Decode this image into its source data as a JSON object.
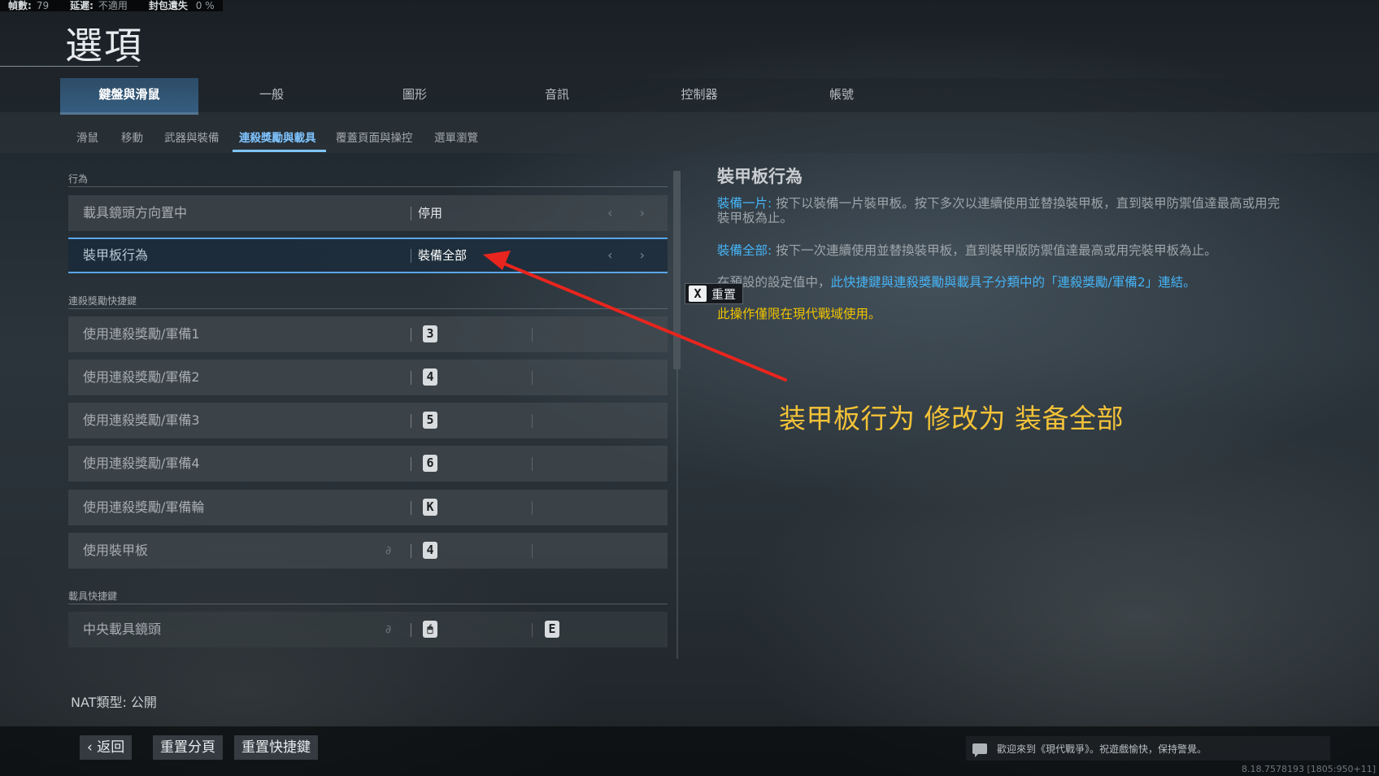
{
  "stats": [
    {
      "label": "幀數:",
      "value": "79"
    },
    {
      "label": "延遲:",
      "value": "不適用"
    },
    {
      "label": "封包遺失",
      "value": "0 %"
    }
  ],
  "page_title": "選項",
  "main_tabs": [
    "鍵盤與滑鼠",
    "一般",
    "圖形",
    "音訊",
    "控制器",
    "帳號"
  ],
  "sub_tabs": [
    "滑鼠",
    "移動",
    "武器與裝備",
    "連殺獎勵與載具",
    "覆蓋頁面與操控",
    "選單瀏覽"
  ],
  "sections": {
    "behavior": "行為",
    "killstreak": "連殺獎勵快捷鍵",
    "vehicle": "載具快捷鍵"
  },
  "rows": {
    "camera": {
      "label": "載具鏡頭方向置中",
      "value": "停用"
    },
    "armor_behavior": {
      "label": "裝甲板行為",
      "value": "裝備全部"
    },
    "ks1": {
      "label": "使用連殺獎勵/軍備1",
      "key": "3"
    },
    "ks2": {
      "label": "使用連殺獎勵/軍備2",
      "key": "4"
    },
    "ks3": {
      "label": "使用連殺獎勵/軍備3",
      "key": "5"
    },
    "ks4": {
      "label": "使用連殺獎勵/軍備4",
      "key": "6"
    },
    "ks_wheel": {
      "label": "使用連殺獎勵/軍備輪",
      "key": "K"
    },
    "use_armor": {
      "label": "使用裝甲板",
      "key": "4"
    },
    "center_cam": {
      "label": "中央載具鏡頭",
      "key": "🖱",
      "key2": "E"
    }
  },
  "arrows": "‹ ›",
  "detail": {
    "title": "裝甲板行為",
    "p1_hl": "裝備一片:",
    "p1": "按下以裝備一片裝甲板。按下多次以連續使用並替換裝甲板，直到裝甲防禦值達最高或用完裝甲板為止。",
    "p2_hl": "裝備全部:",
    "p2": "按下一次連續使用並替換裝甲板，直到裝甲版防禦值達最高或用完裝甲板為止。",
    "p3": "在預設的設定值中，",
    "p3_hl": "此快捷鍵與連殺獎勵與載具子分類中的「連殺獎勵/軍備2」連結。",
    "p4": "此操作僅限在現代戰域使用。"
  },
  "reset": {
    "key": "X",
    "label": "重置"
  },
  "annotation": "装甲板行为 修改为 装备全部",
  "nat": "NAT類型:  公開",
  "footer": {
    "back": "返回",
    "reset_page": "重置分頁",
    "reset_keys": "重置快捷鍵"
  },
  "chat": "歡迎來到《現代戰爭》。祝遊戲愉快，保持警覺。",
  "version": "8.18.7578193 [1805:950+11]",
  "colors": {
    "accent": "#7fc4ff",
    "highlight": "#46b4f5",
    "warning": "#f1c400",
    "annotation": "#f3c238",
    "arrow": "#e8251e"
  }
}
